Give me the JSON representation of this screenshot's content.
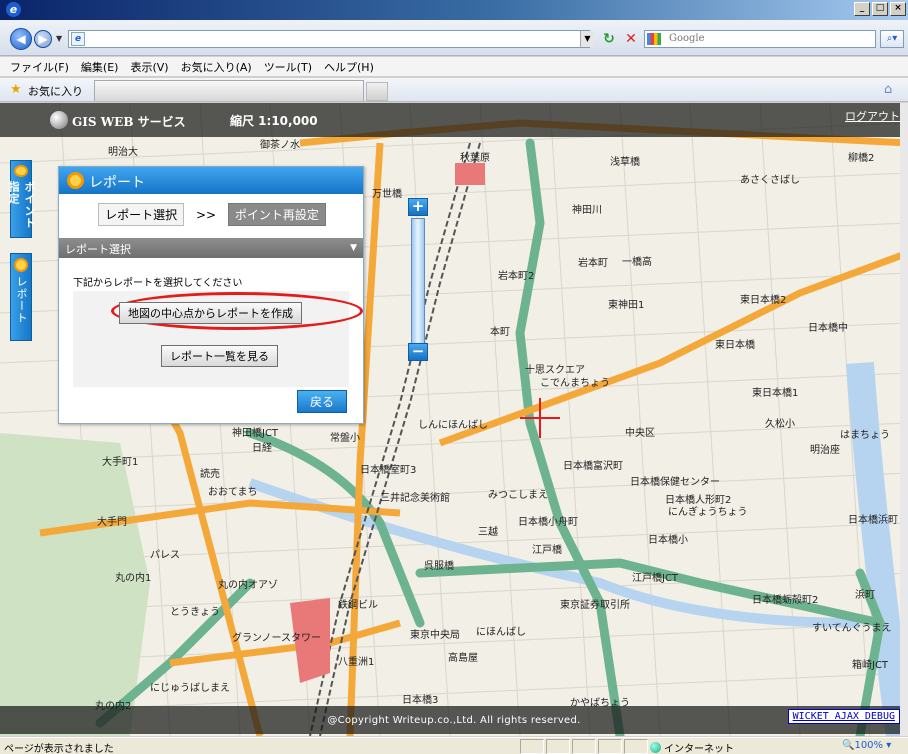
{
  "browser": {
    "url": "",
    "search_engine": "Google",
    "menu": [
      "ファイル(F)",
      "編集(E)",
      "表示(V)",
      "お気に入り(A)",
      "ツール(T)",
      "ヘルプ(H)"
    ],
    "favorites_label": "お気に入り",
    "status": "ページが表示されました",
    "zone": "インターネット",
    "zoom": "100%"
  },
  "gis": {
    "title": "GIS WEB サービス",
    "scale": "縮尺 1:10,000",
    "logout": "ログアウト",
    "copyright": "@Copyright Writeup.co.,Ltd. All rights reserved.",
    "debug": "WICKET AJAX DEBUG",
    "tab_point": "ポイント指定",
    "tab_report": "レポート"
  },
  "panel": {
    "title": "レポート",
    "step1": "レポート選択",
    "separator": ">>",
    "step2": "ポイント再設定",
    "section": "レポート選択",
    "instruction": "下記からレポートを選択してください",
    "create_btn": "地図の中心点からレポートを作成",
    "list_btn": "レポート一覧を見る",
    "back_btn": "戻る"
  },
  "map_labels": [
    "明治大",
    "御茶ノ水",
    "秋葉原",
    "浅草橋",
    "柳橋2",
    "あさくさばし",
    "万世橋",
    "神田川",
    "岩本町2",
    "一橋高",
    "東神田1",
    "東日本橋2",
    "日本橋中",
    "岩本町",
    "東日本橋",
    "本町",
    "十思スクエア",
    "こでんまちょう",
    "中央区",
    "東日本橋1",
    "久松小",
    "日本橋浜町",
    "浜町",
    "しんにほんばし",
    "神田橋JCT",
    "日経",
    "常盤小",
    "日本橋室町3",
    "日本橋富沢町",
    "日本橋保健センター",
    "日本橋人形町2",
    "にんぎょうちょう",
    "大手町1",
    "読売",
    "おおてまち",
    "三井記念美術館",
    "みつこしまえ",
    "日本橋小舟町",
    "大手門",
    "三越",
    "日本橋小",
    "江戸橋",
    "江戸橋JCT",
    "パレス",
    "丸の内1",
    "丸の内オアゾ",
    "鉄鋼ビル",
    "東京証券取引所",
    "日本橋蛎殻町2",
    "とうきょう",
    "グランノースタワー",
    "東京中央局",
    "にほんばし",
    "高島屋",
    "八重洲1",
    "すいてんぐうまえ",
    "箱崎JCT",
    "にじゅうばしまえ",
    "丸の内2",
    "日本橋3",
    "かやばちょう",
    "明治座",
    "はまちょう",
    "呉服橋"
  ],
  "colors": {
    "panel_blue": "#1673c7",
    "highlight_red": "#e31b1b",
    "road_green": "#6db38f",
    "road_orange": "#f4a83a"
  }
}
